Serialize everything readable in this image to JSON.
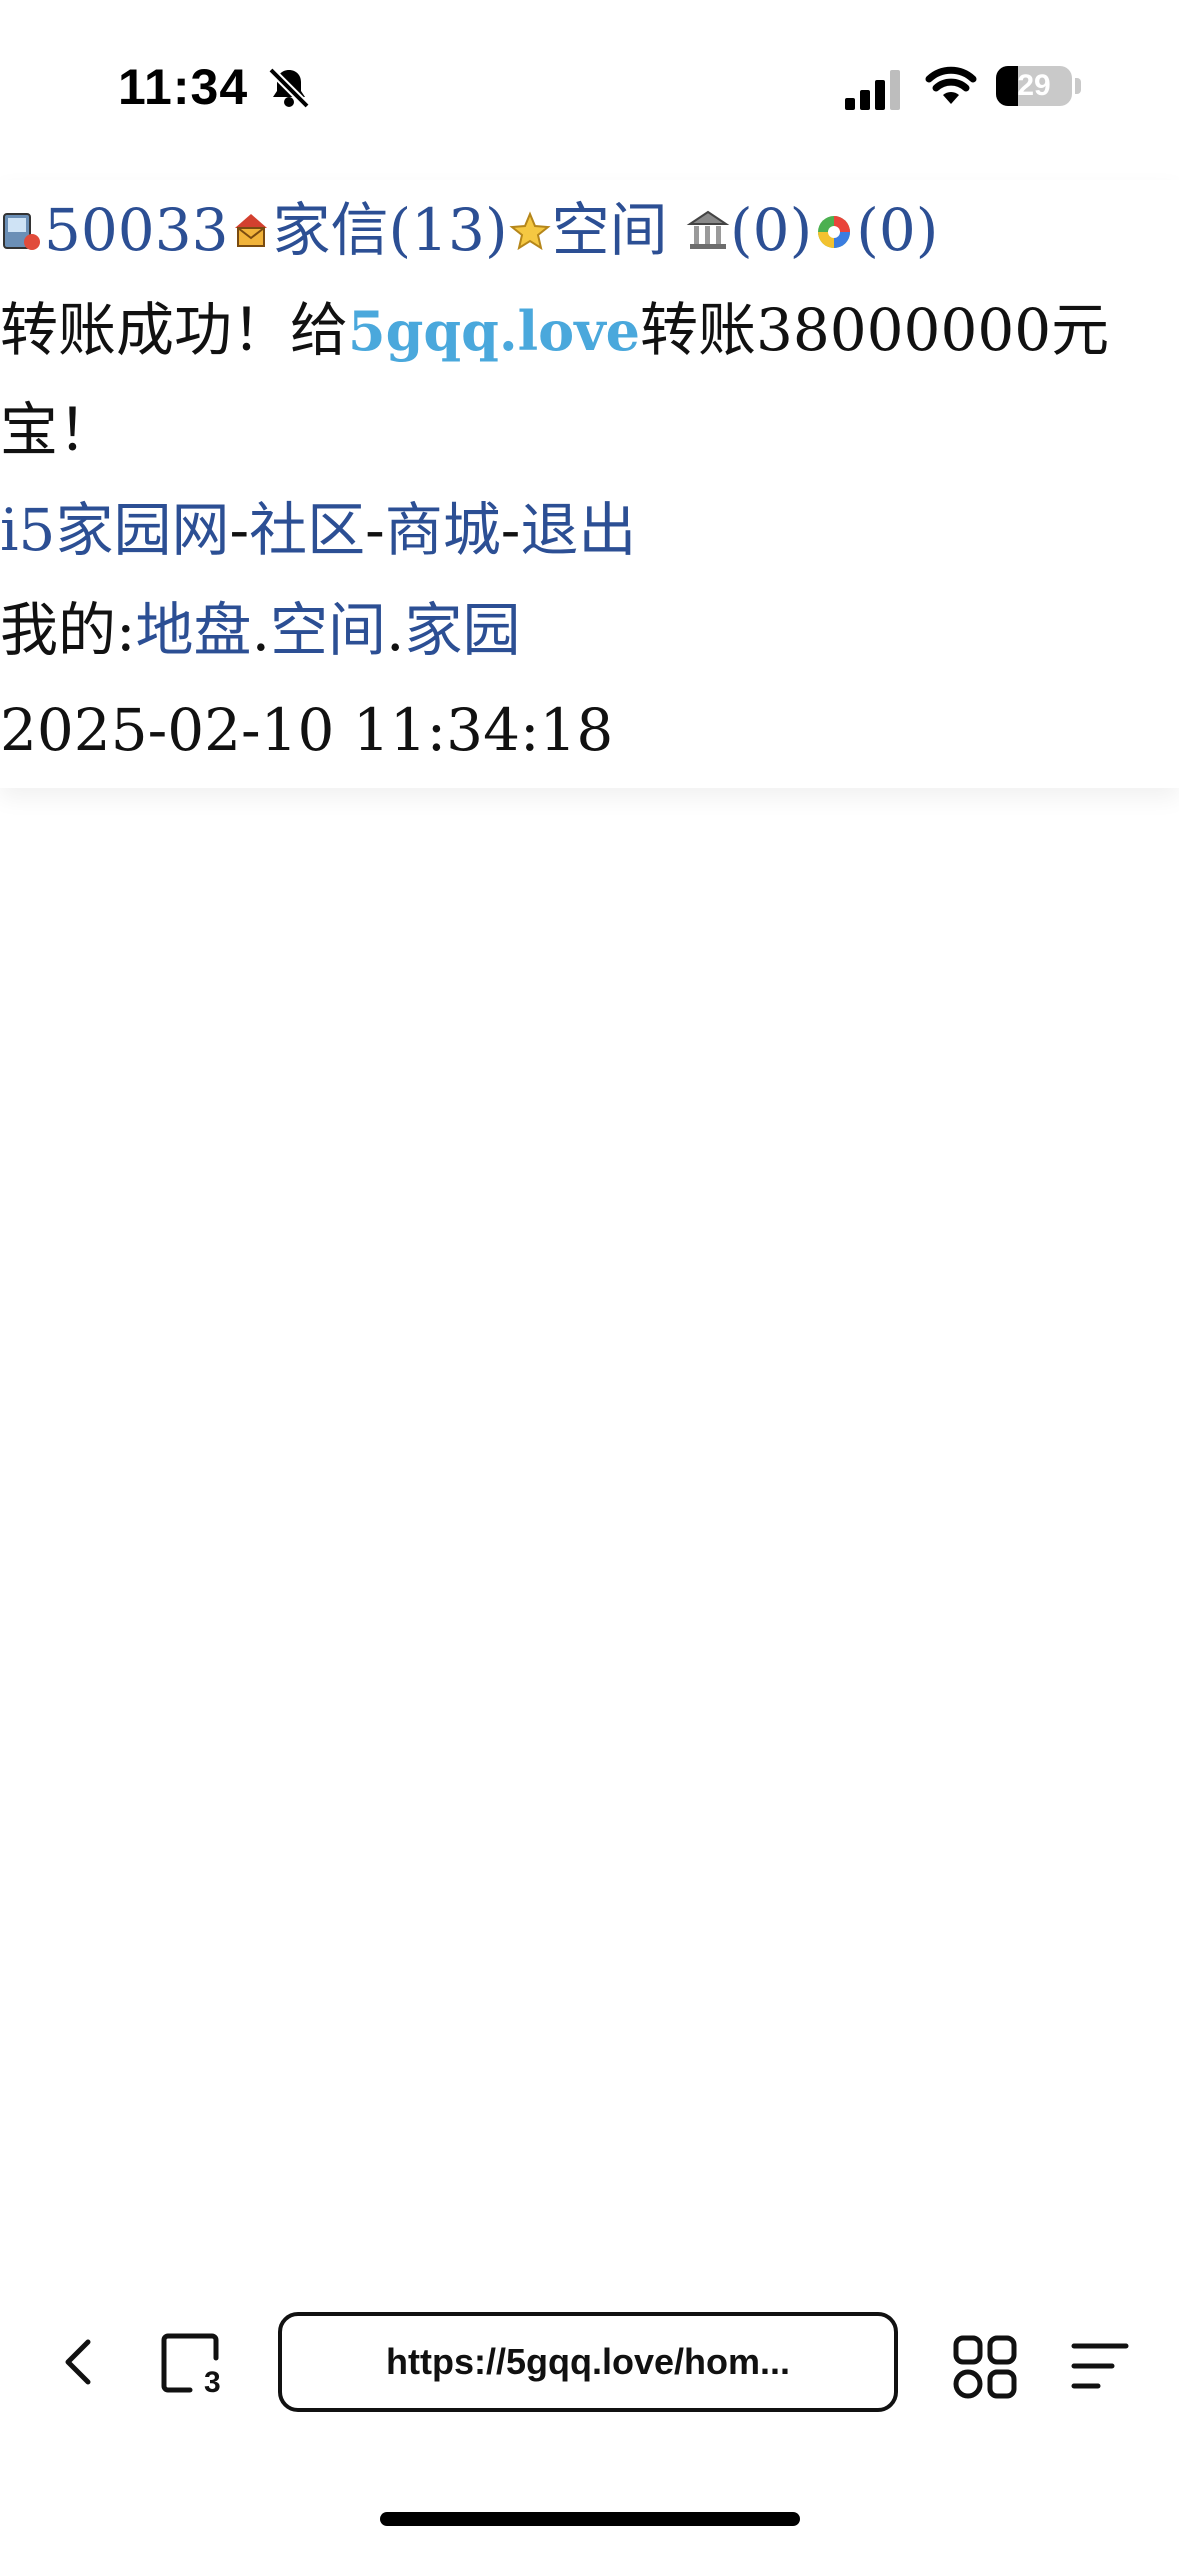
{
  "status": {
    "time": "11:34",
    "battery": "29",
    "battery_fraction": 0.29
  },
  "header": {
    "user_id": "50033",
    "mail_label": "家信",
    "mail_count": "(13)",
    "space_label": "空间",
    "bank_count": "(0)",
    "lottery_count": "(0)"
  },
  "message": {
    "prefix": "转账成功！给",
    "recipient": "5gqq.love",
    "suffix_line1": "转账38000000元",
    "suffix_line2": "宝！"
  },
  "nav": {
    "home": "i5家园网",
    "sep1": "-",
    "community": "社区",
    "sep2": "-",
    "mall": "商城",
    "sep3": "-",
    "logout": "退出"
  },
  "mine": {
    "label": "我的:",
    "land": "地盘",
    "dot1": ".",
    "space": "空间",
    "dot2": ".",
    "home": "家园"
  },
  "timestamp": "2025-02-10 11:34:18",
  "browser": {
    "url": "https://5gqq.love/hom...",
    "tabs_count": "3"
  }
}
